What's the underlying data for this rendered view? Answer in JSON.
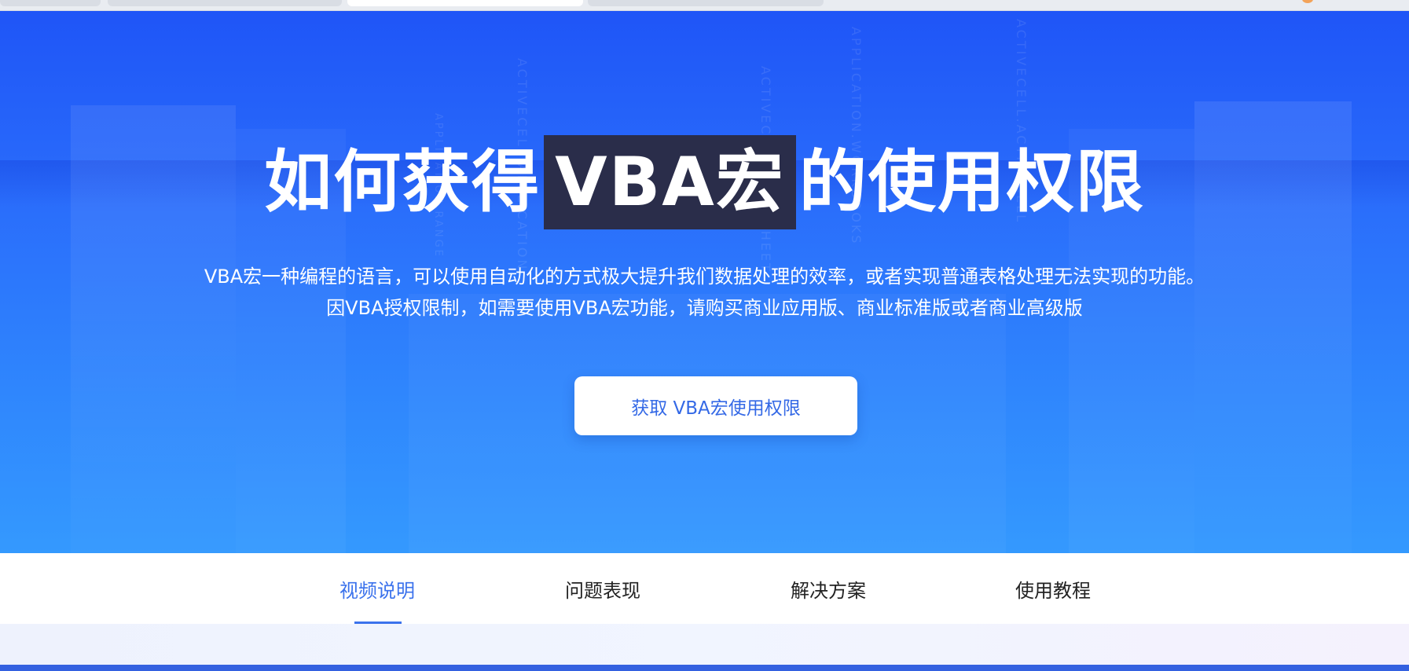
{
  "hero": {
    "title_before": "如何获得",
    "title_highlight": "VBA宏",
    "title_after": "的使用权限",
    "subtitle_line1": "VBA宏一种编程的语言，可以使用自动化的方式极大提升我们数据处理的效率，或者实现普通表格处理无法实现的功能。",
    "subtitle_line2": "因VBA授权限制，如需要使用VBA宏功能，请购买商业应用版、商业标准版或者商业高级版",
    "cta_label": "获取 VBA宏使用权限"
  },
  "tabs": [
    {
      "label": "视频说明",
      "active": true
    },
    {
      "label": "问题表现",
      "active": false
    },
    {
      "label": "解决方案",
      "active": false
    },
    {
      "label": "使用教程",
      "active": false
    }
  ],
  "colors": {
    "hero_top": "#1f55f7",
    "hero_bottom": "#3499fe",
    "highlight_bg": "#2a2d4a",
    "accent": "#3b72ec"
  }
}
